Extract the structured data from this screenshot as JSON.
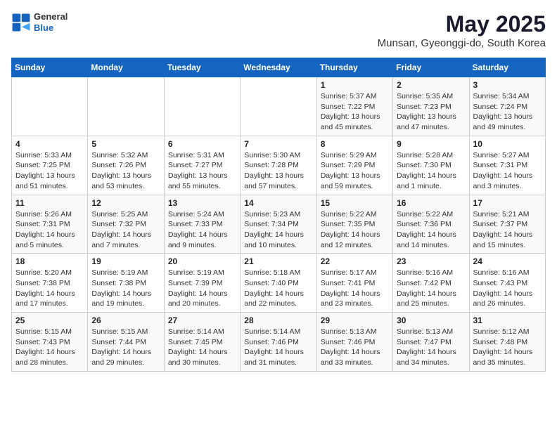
{
  "header": {
    "logo_general": "General",
    "logo_blue": "Blue",
    "title": "May 2025",
    "subtitle": "Munsan, Gyeonggi-do, South Korea"
  },
  "days_of_week": [
    "Sunday",
    "Monday",
    "Tuesday",
    "Wednesday",
    "Thursday",
    "Friday",
    "Saturday"
  ],
  "weeks": [
    [
      {
        "day": "",
        "info": ""
      },
      {
        "day": "",
        "info": ""
      },
      {
        "day": "",
        "info": ""
      },
      {
        "day": "",
        "info": ""
      },
      {
        "day": "1",
        "info": "Sunrise: 5:37 AM\nSunset: 7:22 PM\nDaylight: 13 hours\nand 45 minutes."
      },
      {
        "day": "2",
        "info": "Sunrise: 5:35 AM\nSunset: 7:23 PM\nDaylight: 13 hours\nand 47 minutes."
      },
      {
        "day": "3",
        "info": "Sunrise: 5:34 AM\nSunset: 7:24 PM\nDaylight: 13 hours\nand 49 minutes."
      }
    ],
    [
      {
        "day": "4",
        "info": "Sunrise: 5:33 AM\nSunset: 7:25 PM\nDaylight: 13 hours\nand 51 minutes."
      },
      {
        "day": "5",
        "info": "Sunrise: 5:32 AM\nSunset: 7:26 PM\nDaylight: 13 hours\nand 53 minutes."
      },
      {
        "day": "6",
        "info": "Sunrise: 5:31 AM\nSunset: 7:27 PM\nDaylight: 13 hours\nand 55 minutes."
      },
      {
        "day": "7",
        "info": "Sunrise: 5:30 AM\nSunset: 7:28 PM\nDaylight: 13 hours\nand 57 minutes."
      },
      {
        "day": "8",
        "info": "Sunrise: 5:29 AM\nSunset: 7:29 PM\nDaylight: 13 hours\nand 59 minutes."
      },
      {
        "day": "9",
        "info": "Sunrise: 5:28 AM\nSunset: 7:30 PM\nDaylight: 14 hours\nand 1 minute."
      },
      {
        "day": "10",
        "info": "Sunrise: 5:27 AM\nSunset: 7:31 PM\nDaylight: 14 hours\nand 3 minutes."
      }
    ],
    [
      {
        "day": "11",
        "info": "Sunrise: 5:26 AM\nSunset: 7:31 PM\nDaylight: 14 hours\nand 5 minutes."
      },
      {
        "day": "12",
        "info": "Sunrise: 5:25 AM\nSunset: 7:32 PM\nDaylight: 14 hours\nand 7 minutes."
      },
      {
        "day": "13",
        "info": "Sunrise: 5:24 AM\nSunset: 7:33 PM\nDaylight: 14 hours\nand 9 minutes."
      },
      {
        "day": "14",
        "info": "Sunrise: 5:23 AM\nSunset: 7:34 PM\nDaylight: 14 hours\nand 10 minutes."
      },
      {
        "day": "15",
        "info": "Sunrise: 5:22 AM\nSunset: 7:35 PM\nDaylight: 14 hours\nand 12 minutes."
      },
      {
        "day": "16",
        "info": "Sunrise: 5:22 AM\nSunset: 7:36 PM\nDaylight: 14 hours\nand 14 minutes."
      },
      {
        "day": "17",
        "info": "Sunrise: 5:21 AM\nSunset: 7:37 PM\nDaylight: 14 hours\nand 15 minutes."
      }
    ],
    [
      {
        "day": "18",
        "info": "Sunrise: 5:20 AM\nSunset: 7:38 PM\nDaylight: 14 hours\nand 17 minutes."
      },
      {
        "day": "19",
        "info": "Sunrise: 5:19 AM\nSunset: 7:38 PM\nDaylight: 14 hours\nand 19 minutes."
      },
      {
        "day": "20",
        "info": "Sunrise: 5:19 AM\nSunset: 7:39 PM\nDaylight: 14 hours\nand 20 minutes."
      },
      {
        "day": "21",
        "info": "Sunrise: 5:18 AM\nSunset: 7:40 PM\nDaylight: 14 hours\nand 22 minutes."
      },
      {
        "day": "22",
        "info": "Sunrise: 5:17 AM\nSunset: 7:41 PM\nDaylight: 14 hours\nand 23 minutes."
      },
      {
        "day": "23",
        "info": "Sunrise: 5:16 AM\nSunset: 7:42 PM\nDaylight: 14 hours\nand 25 minutes."
      },
      {
        "day": "24",
        "info": "Sunrise: 5:16 AM\nSunset: 7:43 PM\nDaylight: 14 hours\nand 26 minutes."
      }
    ],
    [
      {
        "day": "25",
        "info": "Sunrise: 5:15 AM\nSunset: 7:43 PM\nDaylight: 14 hours\nand 28 minutes."
      },
      {
        "day": "26",
        "info": "Sunrise: 5:15 AM\nSunset: 7:44 PM\nDaylight: 14 hours\nand 29 minutes."
      },
      {
        "day": "27",
        "info": "Sunrise: 5:14 AM\nSunset: 7:45 PM\nDaylight: 14 hours\nand 30 minutes."
      },
      {
        "day": "28",
        "info": "Sunrise: 5:14 AM\nSunset: 7:46 PM\nDaylight: 14 hours\nand 31 minutes."
      },
      {
        "day": "29",
        "info": "Sunrise: 5:13 AM\nSunset: 7:46 PM\nDaylight: 14 hours\nand 33 minutes."
      },
      {
        "day": "30",
        "info": "Sunrise: 5:13 AM\nSunset: 7:47 PM\nDaylight: 14 hours\nand 34 minutes."
      },
      {
        "day": "31",
        "info": "Sunrise: 5:12 AM\nSunset: 7:48 PM\nDaylight: 14 hours\nand 35 minutes."
      }
    ]
  ]
}
